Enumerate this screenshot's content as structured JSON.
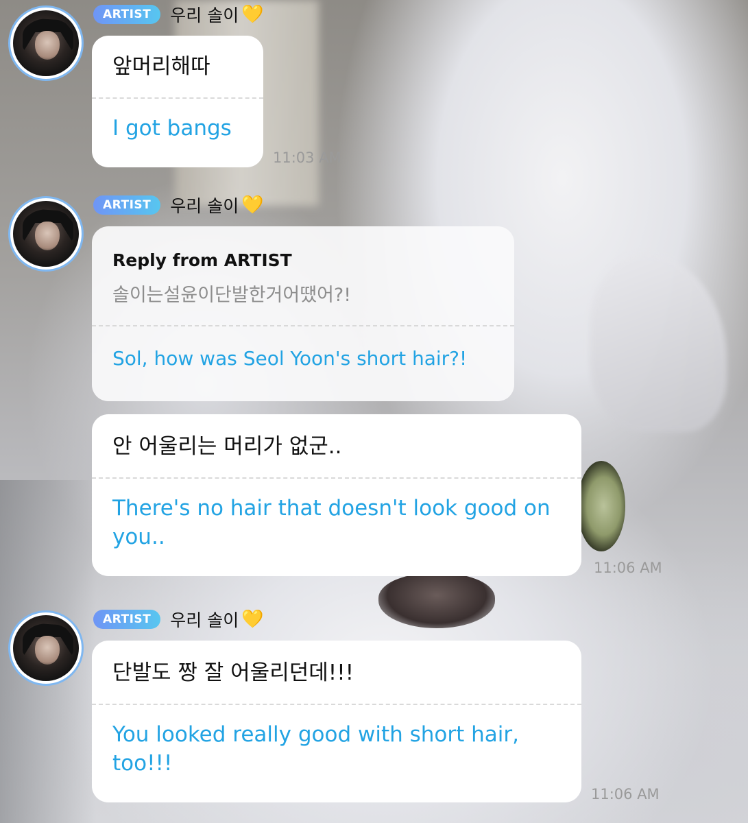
{
  "background": {
    "description_colors": {
      "fur": "#e6e7eb",
      "eye": "#9aa36f",
      "nose": "#3a3030"
    }
  },
  "colors": {
    "badge_start": "#6f95f5",
    "badge_end": "#57c6f0",
    "translation_text": "#22a3e3",
    "avatar_ring": "#7fb7f0"
  },
  "messages": [
    {
      "badge": "ARTIST",
      "name": "우리 솔이",
      "heart": "💛",
      "korean": "앞머리해따",
      "english": "I got bangs",
      "time": "11:03 AM"
    },
    {
      "badge": "ARTIST",
      "name": "우리 솔이",
      "heart": "💛",
      "reply": {
        "label": "Reply from ARTIST",
        "korean": "솔이는설윤이단발한거어땠어?!",
        "english": "Sol, how was Seol Yoon's short hair?!"
      },
      "korean": "안 어울리는 머리가 없군..",
      "english": "There's no hair that doesn't look good on you..",
      "time": "11:06 AM"
    },
    {
      "badge": "ARTIST",
      "name": "우리 솔이",
      "heart": "💛",
      "korean": "단발도 짱 잘 어울리던데!!!",
      "english": "You looked really good with short hair, too!!!",
      "time": "11:06 AM"
    }
  ]
}
